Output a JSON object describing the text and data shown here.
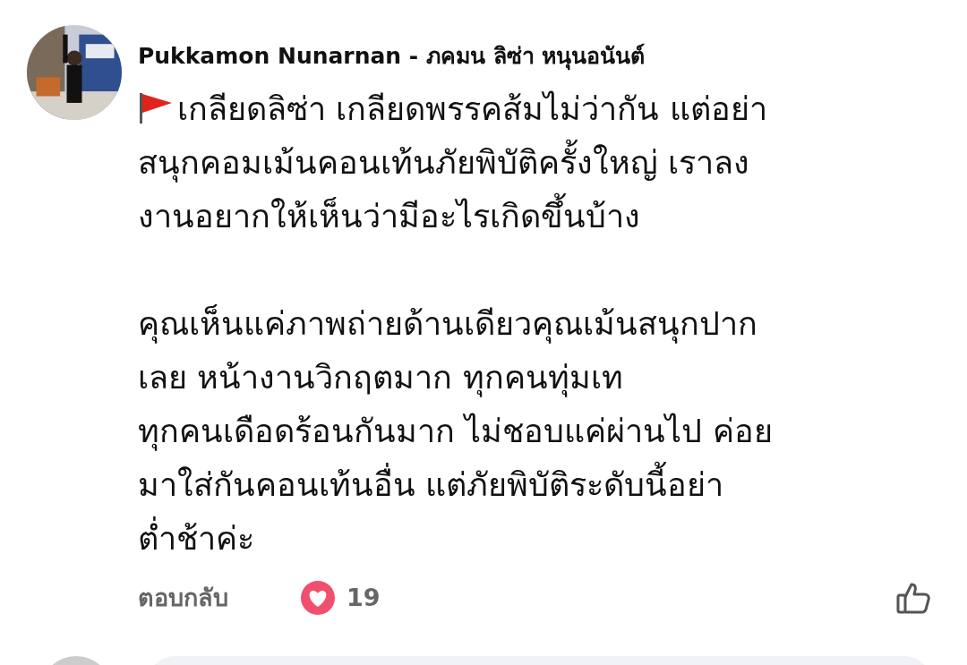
{
  "comment": {
    "author": "Pukkamon Nunarnan - ภคมน ลิซ่า หนุนอนันต์",
    "paragraphs": [
      {
        "lines": [
          "เกลียดลิซ่า เกลียดพรรคส้มไม่ว่ากัน แต่อย่า",
          "สนุกคอมเม้นคอนเท้นภัยพิบัติครั้งใหญ่ เราลง",
          "งานอยากให้เห็นว่ามีอะไรเกิดขึ้นบ้าง"
        ]
      },
      {
        "lines": [
          "คุณเห็นแค่ภาพถ่ายด้านเดียวคุณเม้นสนุกปาก",
          "เลย หน้างานวิกฤตมาก ทุกคนทุ่มเท",
          "ทุกคนเดือดร้อนกันมาก ไม่ชอบแค่ผ่านไป ค่อย",
          "มาใส่กันคอนเท้นอื่น แต่ภัยพิบัติระดับนี้อย่า",
          "ต่ำช้าค่ะ"
        ]
      }
    ],
    "reply_label": "ตอบกลับ",
    "reaction_count": "19"
  }
}
